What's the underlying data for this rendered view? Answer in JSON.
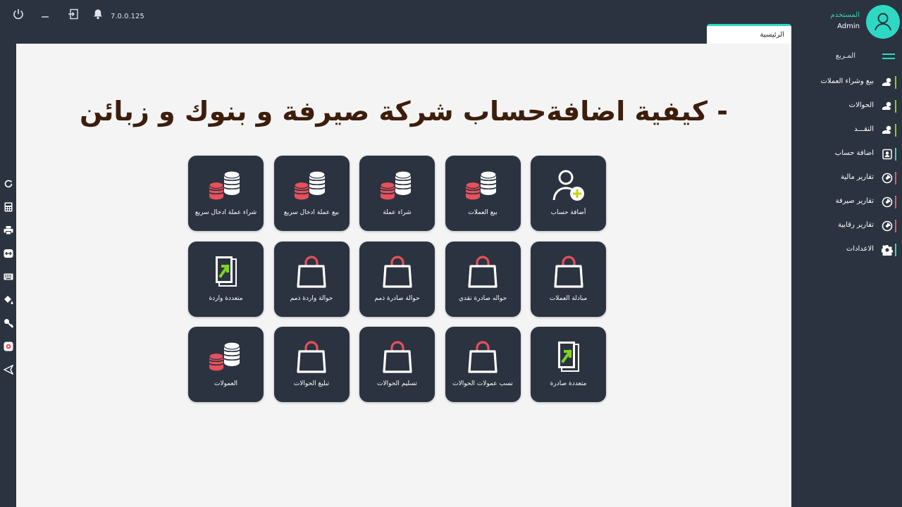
{
  "topbar": {
    "version": "7.0.0.125",
    "user_role": "المستخدم",
    "user_name": "Admin",
    "tab_label": "الرئيسية"
  },
  "main": {
    "headline": "- كيفية اضافةحساب شركة صيرفة و بنوك و زبائن",
    "cards": [
      {
        "label": "أضافة حساب",
        "icon": "add-user-icon"
      },
      {
        "label": "بيع العملات",
        "icon": "coins-icon"
      },
      {
        "label": "شراء عملة",
        "icon": "coins-icon"
      },
      {
        "label": "بيع عملة ادخال سريع",
        "icon": "coins-icon"
      },
      {
        "label": "شراء عملة ادخال سريع",
        "icon": "coins-icon"
      },
      {
        "label": "مبادلة العملات",
        "icon": "shopping-bag-icon"
      },
      {
        "label": "حواله صادرة نقدي",
        "icon": "shopping-bag-icon"
      },
      {
        "label": "حوالة صادرة ذمم",
        "icon": "shopping-bag-icon"
      },
      {
        "label": "حوالة واردة ذمم",
        "icon": "shopping-bag-icon"
      },
      {
        "label": "متعددة واردة",
        "icon": "transfer-document-icon"
      },
      {
        "label": "متعددة صادرة",
        "icon": "transfer-document-icon"
      },
      {
        "label": "نسب عمولات الحوالات",
        "icon": "shopping-bag-icon"
      },
      {
        "label": "تسليم الحوالات",
        "icon": "shopping-bag-icon"
      },
      {
        "label": "تبليغ الحوالات",
        "icon": "shopping-bag-icon"
      },
      {
        "label": "العمولات",
        "icon": "coins-icon"
      }
    ]
  },
  "sidebar": {
    "home_label": "المـربع",
    "items": [
      {
        "label": "بيع وشراء العملات",
        "icon": "hand-coin-icon",
        "bar_color": "#7ed321"
      },
      {
        "label": "الحوالات",
        "icon": "hand-coin-icon",
        "bar_color": "#7ed321"
      },
      {
        "label": "النقـــد",
        "icon": "hand-coin-icon",
        "bar_color": "#7ed321"
      },
      {
        "label": "اضافة حساب",
        "icon": "contact-card-icon",
        "bar_color": "#2ed9c3"
      },
      {
        "label": "تقارير مالية",
        "icon": "report-chart-icon",
        "bar_color": "#e85c5c"
      },
      {
        "label": "تقارير صيرفة",
        "icon": "report-chart-icon",
        "bar_color": "#e85c5c"
      },
      {
        "label": "تقارير رقابية",
        "icon": "report-chart-icon",
        "bar_color": "#e85c5c"
      },
      {
        "label": "الاعدادات",
        "icon": "gear-icon",
        "bar_color": "#2ed9c3"
      }
    ]
  },
  "colors": {
    "accent": "#2ed9c3",
    "coin_red": "#e8505b",
    "green": "#7ed321"
  }
}
